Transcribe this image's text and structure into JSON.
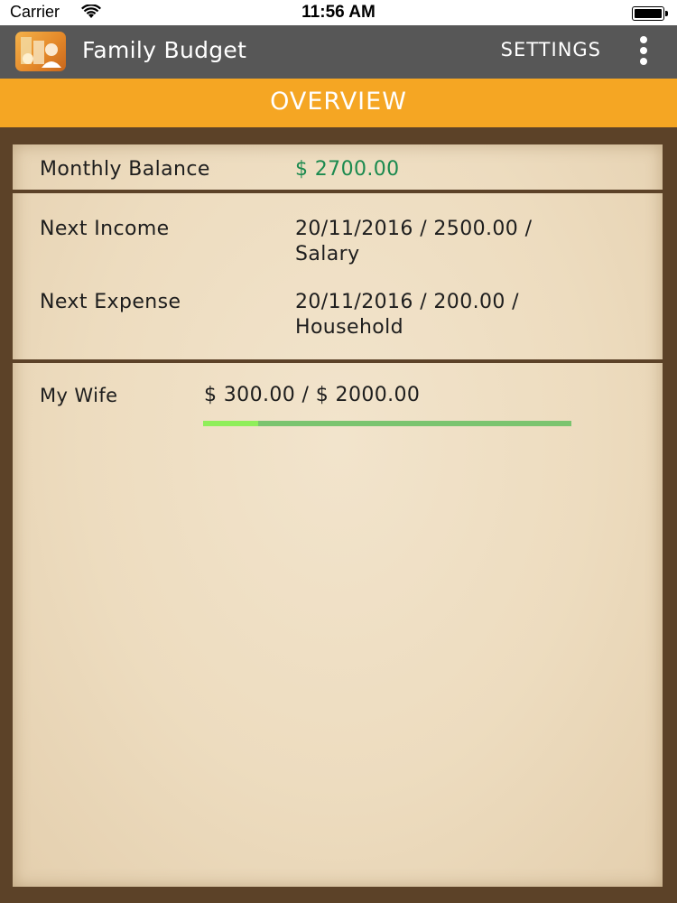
{
  "status_bar": {
    "carrier": "Carrier",
    "time": "11:56 AM",
    "icons": [
      "wifi-icon",
      "battery-icon"
    ]
  },
  "app_bar": {
    "title": "Family Budget",
    "settings_label": "SETTINGS",
    "icons": [
      "app-logo",
      "more-vert-icon"
    ]
  },
  "tabs": {
    "active": "OVERVIEW"
  },
  "overview": {
    "monthly_balance_label": "Monthly Balance",
    "monthly_balance_value": "$ 2700.00",
    "next_income_label": "Next Income",
    "next_income_line1": "20/11/2016 / 2500.00 /",
    "next_income_line2": "Salary",
    "next_expense_label": "Next Expense",
    "next_expense_line1": "20/11/2016 / 200.00 /",
    "next_expense_line2": "Household"
  },
  "budgets": [
    {
      "name": "My Wife",
      "amount_text": "$ 300.00 / $ 2000.00",
      "spent": 300.0,
      "limit": 2000.0
    }
  ],
  "colors": {
    "app_bar": "#575757",
    "tab_bar": "#f5a623",
    "balance_text": "#1b8a4f",
    "frame": "#5c4228",
    "progress_track": "#7bc46f",
    "progress_fill": "#90ee5a"
  }
}
